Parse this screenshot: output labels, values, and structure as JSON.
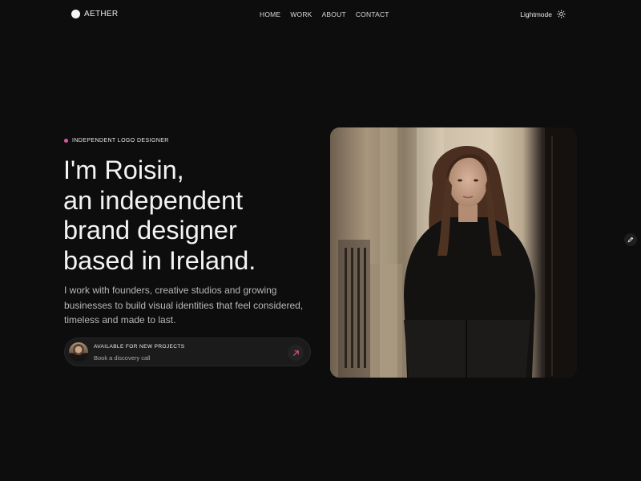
{
  "nav": {
    "brand": "AETHER",
    "links": [
      "HOME",
      "WORK",
      "ABOUT",
      "CONTACT"
    ],
    "mode_label": "Lightmode",
    "mode_icon": "sun-icon"
  },
  "hero": {
    "tagline": "INDEPENDENT LOGO DESIGNER",
    "accent_color": "#e0569a",
    "headline": [
      "I'm Roisin,",
      "an independent",
      "brand designer",
      "based in Ireland."
    ],
    "lead": "I work with founders, creative studios and growing businesses to build visual identities that feel considered, timeless and made to last.",
    "cta": {
      "title": "AVAILABLE FOR NEW PROJECTS",
      "subtitle": "Book a discovery call",
      "icon": "arrow-up-right-icon"
    }
  },
  "side_button": {
    "icon": "pencil-icon"
  }
}
